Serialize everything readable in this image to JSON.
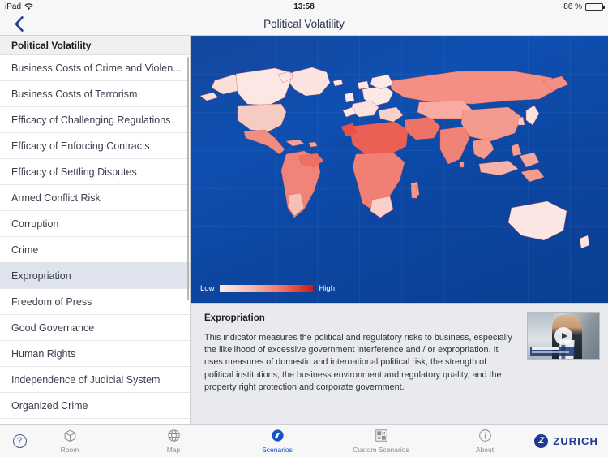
{
  "status_bar": {
    "device": "iPad",
    "wifi_icon": "wifi-icon",
    "time": "13:58",
    "battery_percent": "86 %",
    "battery_level": 86
  },
  "nav": {
    "back_icon": "chevron-left-icon",
    "title": "Political Volatility"
  },
  "sidebar": {
    "header": "Political Volatility",
    "selected": "Expropriation",
    "items": [
      {
        "label": "Business Costs of Crime and Violen..."
      },
      {
        "label": "Business Costs of Terrorism"
      },
      {
        "label": "Efficacy of Challenging Regulations"
      },
      {
        "label": "Efficacy of Enforcing Contracts"
      },
      {
        "label": "Efficacy of Settling Disputes"
      },
      {
        "label": "Armed Conflict Risk"
      },
      {
        "label": "Corruption"
      },
      {
        "label": "Crime"
      },
      {
        "label": "Expropriation"
      },
      {
        "label": "Freedom of Press"
      },
      {
        "label": "Good Governance"
      },
      {
        "label": "Human Rights"
      },
      {
        "label": "Independence of Judicial System"
      },
      {
        "label": "Organized Crime"
      }
    ]
  },
  "map": {
    "legend_low": "Low",
    "legend_high": "High",
    "ocean_color": "#0d4aa5",
    "scale_low_color": "#fdeceb",
    "scale_high_color": "#c81c12"
  },
  "description": {
    "title": "Expropriation",
    "body": "This indicator measures the political and regulatory risks to business, especially the likelihood of excessive government interference and / or expropriation. It uses measures of domestic and international political risk, the strength of political institutions, the business environment and regulatory quality, and the property right protection and corporate government.",
    "video_play_icon": "play-icon"
  },
  "footer": {
    "help_icon": "question-mark-icon",
    "help_label": "?",
    "tabs": [
      {
        "label": "Room",
        "icon": "room-icon",
        "active": false
      },
      {
        "label": "Map",
        "icon": "globe-icon",
        "active": false
      },
      {
        "label": "Scenarios",
        "icon": "scenarios-icon",
        "active": true
      },
      {
        "label": "Custom Scenarios",
        "icon": "custom-scenarios-icon",
        "active": false
      },
      {
        "label": "About",
        "icon": "info-icon",
        "active": false
      }
    ],
    "brand": "ZURICH",
    "brand_mark": "Z",
    "brand_color": "#1f3a93"
  }
}
